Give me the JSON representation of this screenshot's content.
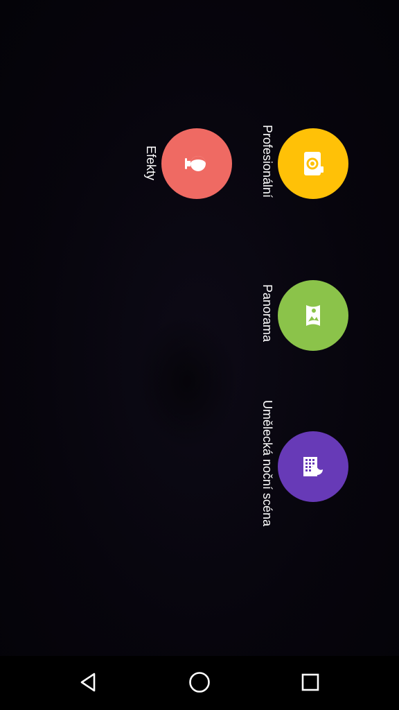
{
  "colors": {
    "professional": "#FFC107",
    "panorama": "#8BC34A",
    "night": "#673AB7",
    "effects": "#EF6A63",
    "label": "#FFFFFF",
    "nav_icon": "#FFFFFF"
  },
  "modes": [
    {
      "id": "professional",
      "label": "Profesionální",
      "icon": "camera-icon"
    },
    {
      "id": "panorama",
      "label": "Panorama",
      "icon": "panorama-icon"
    },
    {
      "id": "night",
      "label": "Umělecká noční scéna",
      "icon": "night-scene-icon"
    },
    {
      "id": "effects",
      "label": "Efekty",
      "icon": "effects-icon"
    }
  ],
  "nav": {
    "back": "back-icon",
    "home": "home-icon",
    "recents": "recents-icon"
  }
}
